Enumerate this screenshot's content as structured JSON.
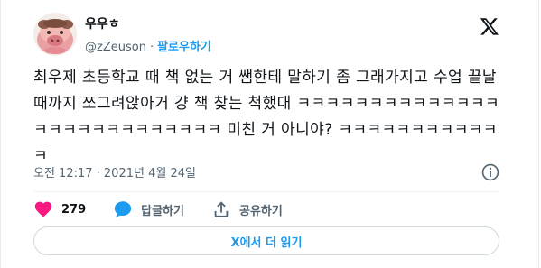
{
  "author": {
    "name": "우우ㅎ",
    "handle": "@zZeuson",
    "separator": "·",
    "follow_label": "팔로우하기"
  },
  "tweet": {
    "text": "최우제 초등학교 때 책 없는 거 쌤한테 말하기 좀 그래가지고 수업 끝날 때까지 쪼그려앉아거 걍 책 찾는 척했대 ㅋㅋㅋㅋㅋㅋㅋㅋㅋㅋㅋㅋㅋㅋㅋㅋㅋㅋㅋㅋㅋㅋㅋㅋㅋㅋㅋ 미친 거 아니야? ㅋㅋㅋㅋㅋㅋㅋㅋㅋㅋㅋㅋ",
    "timestamp": "오전 12:17 · 2021년 4월 24일"
  },
  "actions": {
    "like_count": "279",
    "reply_label": "답글하기",
    "share_label": "공유하기"
  },
  "read_more_label": "X에서 더 읽기",
  "icons": {
    "brand": "x-logo-icon",
    "info": "info-icon",
    "like": "heart-icon",
    "reply": "speech-bubble-icon",
    "share": "share-upload-icon"
  },
  "colors": {
    "accent": "#1d9bf0",
    "like": "#f91880",
    "secondary_text": "#536471",
    "primary_text": "#0f1419",
    "border": "#cfd9de"
  }
}
